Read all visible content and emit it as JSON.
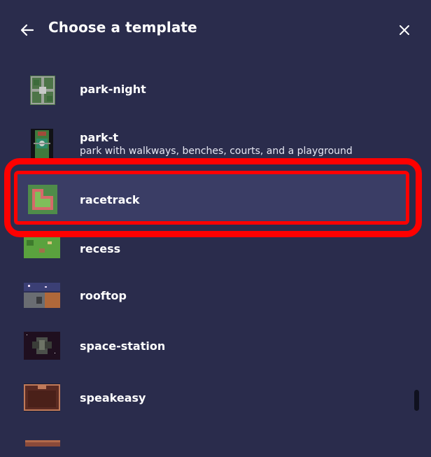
{
  "header": {
    "title": "Choose a template",
    "back_icon": "arrow-left-icon",
    "close_icon": "close-icon"
  },
  "templates": [
    {
      "name": "park-night",
      "description": ""
    },
    {
      "name": "park-t",
      "description": "park with walkways, benches, courts, and a playground"
    },
    {
      "name": "racetrack",
      "description": ""
    },
    {
      "name": "recess",
      "description": ""
    },
    {
      "name": "rooftop",
      "description": ""
    },
    {
      "name": "space-station",
      "description": ""
    },
    {
      "name": "speakeasy",
      "description": ""
    }
  ],
  "selected_template": "racetrack",
  "colors": {
    "background": "#2a2c4c",
    "selected_row": "#3a3d65",
    "annotation": "#ff0000"
  }
}
